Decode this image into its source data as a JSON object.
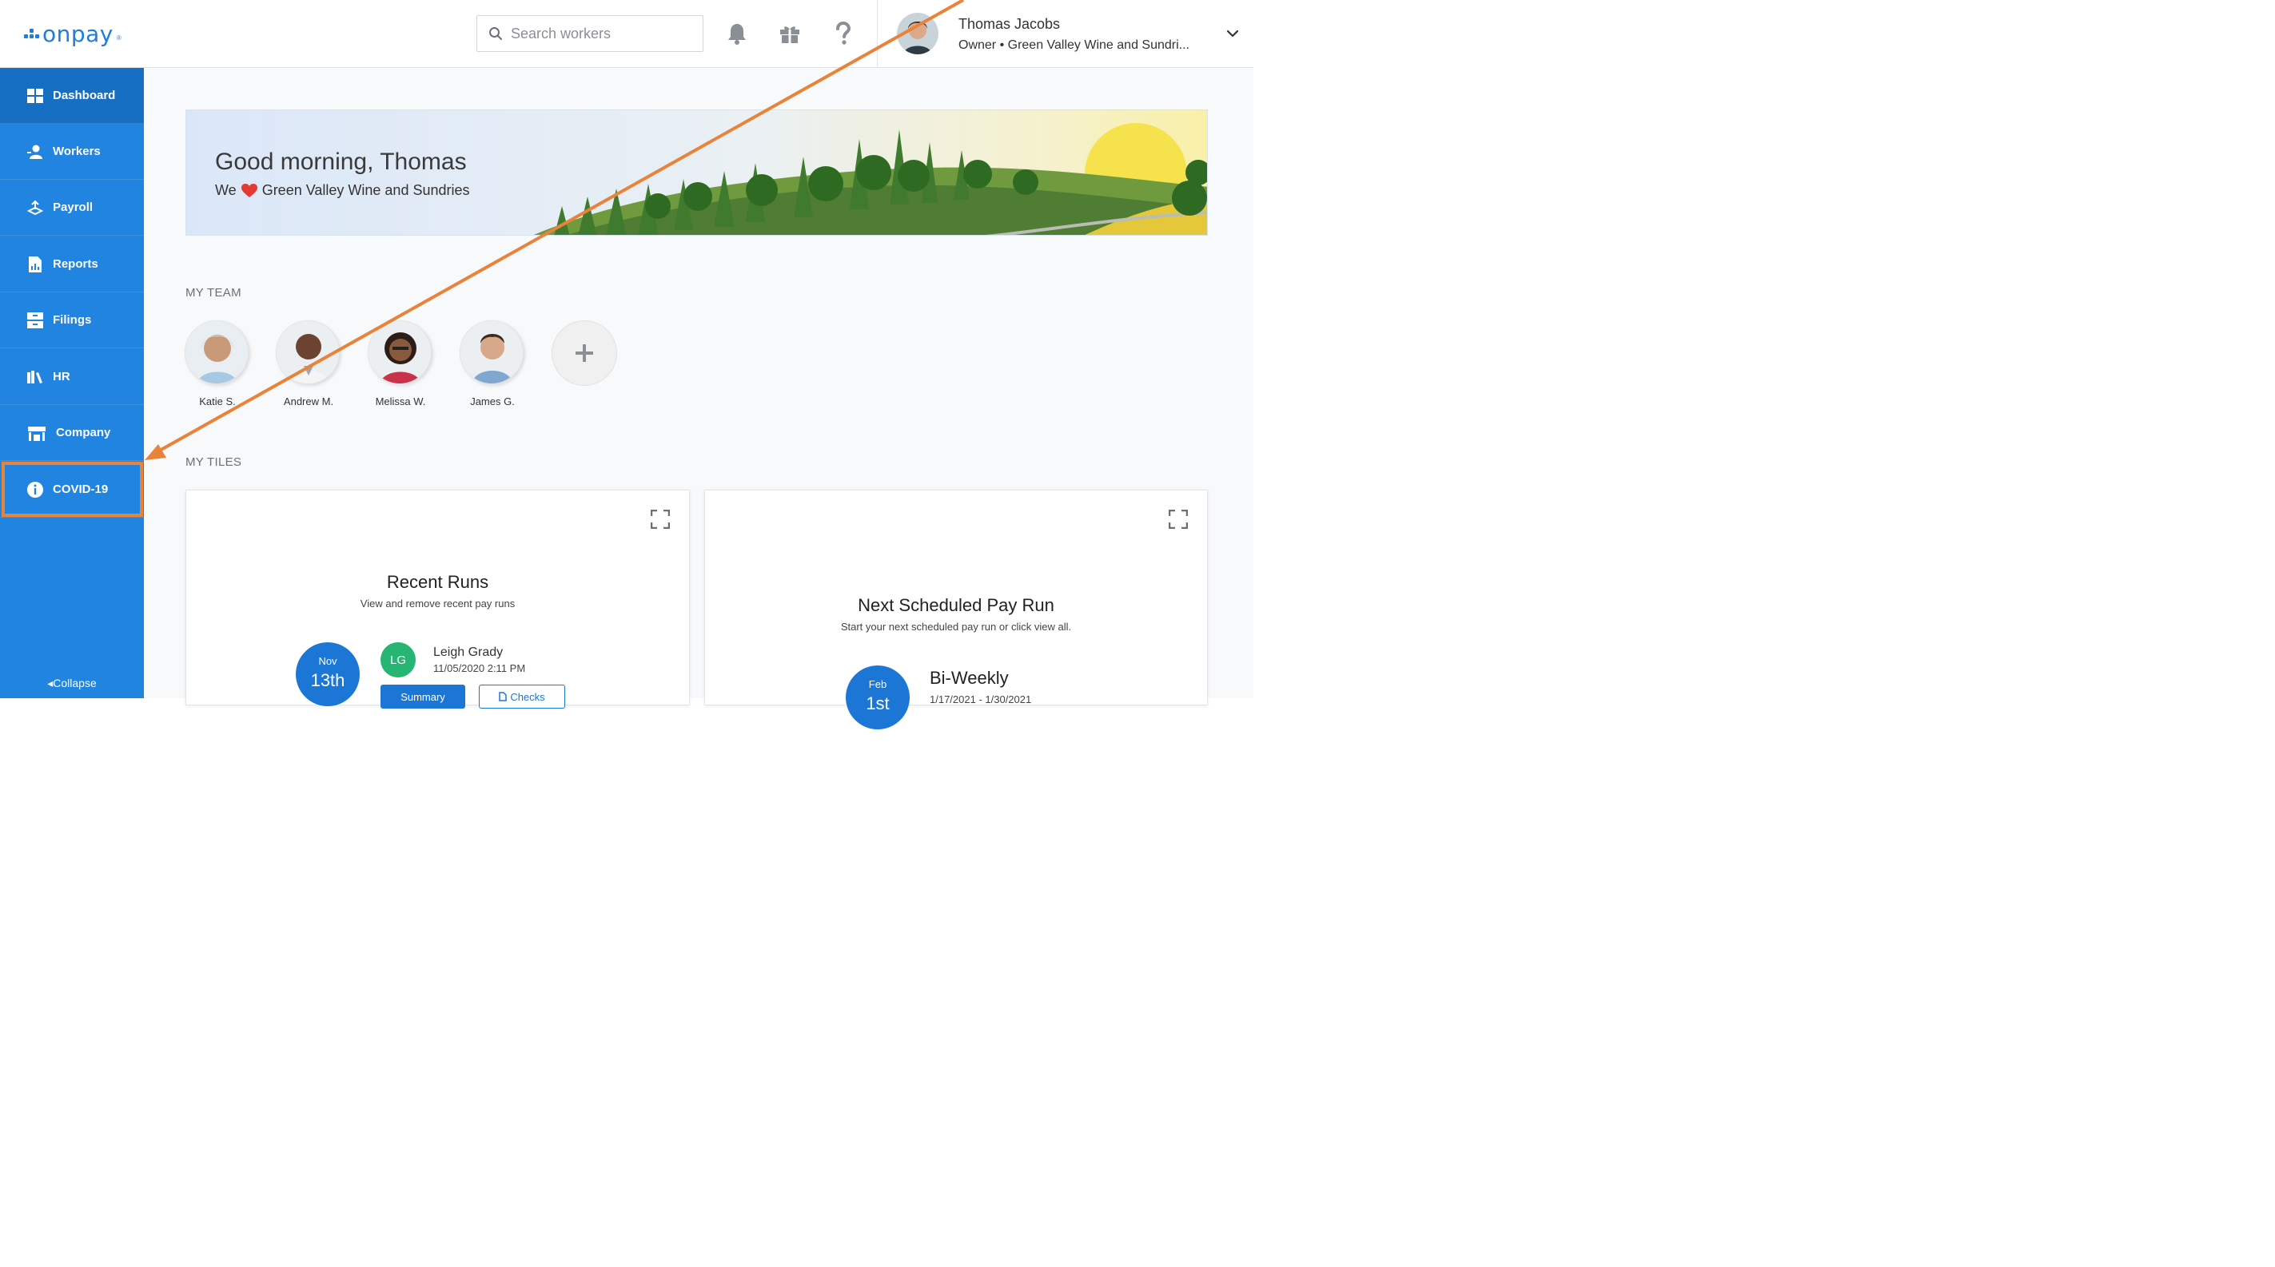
{
  "header": {
    "logo_text": "onpay",
    "logo_mark": "®",
    "search": {
      "placeholder": "Search workers"
    },
    "icons": [
      "bell-icon",
      "gift-icon",
      "help-icon"
    ],
    "user": {
      "name": "Thomas Jacobs",
      "role": "Owner • Green Valley Wine and Sundri..."
    }
  },
  "sidebar": {
    "items": [
      {
        "label": "Dashboard",
        "icon": "dashboard-icon",
        "active": true
      },
      {
        "label": "Workers",
        "icon": "workers-icon"
      },
      {
        "label": "Payroll",
        "icon": "payroll-icon"
      },
      {
        "label": "Reports",
        "icon": "reports-icon"
      },
      {
        "label": "Filings",
        "icon": "filings-icon"
      },
      {
        "label": "HR",
        "icon": "hr-icon"
      },
      {
        "label": "Company",
        "icon": "company-icon"
      },
      {
        "label": "COVID-19",
        "icon": "info-icon"
      }
    ],
    "collapse_label": "Collapse"
  },
  "banner": {
    "greeting": "Good morning, Thomas",
    "we": "We",
    "company": "Green Valley Wine and Sundries"
  },
  "team": {
    "title": "MY TEAM",
    "members": [
      {
        "name": "Katie S."
      },
      {
        "name": "Andrew M."
      },
      {
        "name": "Melissa W."
      },
      {
        "name": "James G."
      }
    ]
  },
  "tiles": {
    "title": "MY TILES",
    "recent_runs": {
      "title": "Recent Runs",
      "subtitle": "View and remove recent pay runs",
      "date_month": "Nov",
      "date_day": "13th",
      "initials": "LG",
      "name": "Leigh Grady",
      "timestamp": "11/05/2020 2:11 PM",
      "summary_label": "Summary",
      "checks_label": "Checks"
    },
    "next_run": {
      "title": "Next Scheduled Pay Run",
      "subtitle": "Start your next scheduled pay run or click view all.",
      "date_month": "Feb",
      "date_day": "1st",
      "frequency": "Bi-Weekly",
      "period": "1/17/2021 - 1/30/2021"
    }
  },
  "colors": {
    "brand": "#1e7ee0",
    "sidebar": "#2184e0",
    "sidebar_active": "#176fc4",
    "annotation": "#e9833a",
    "heart": "#e53935",
    "badge": "#27b574"
  }
}
